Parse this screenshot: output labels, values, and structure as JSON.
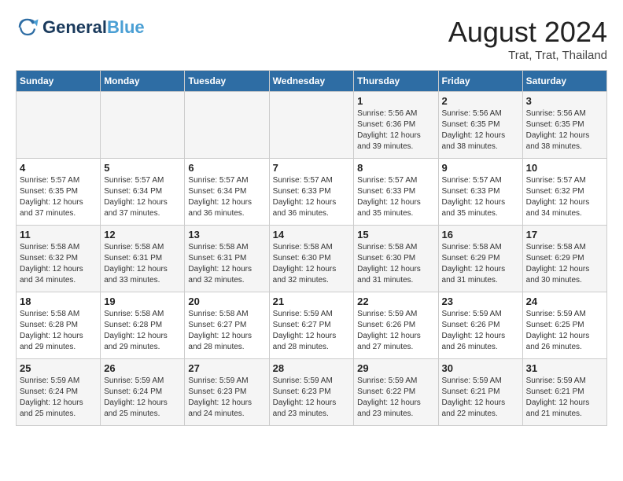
{
  "header": {
    "logo_line1": "General",
    "logo_line2": "Blue",
    "main_title": "August 2024",
    "subtitle": "Trat, Trat, Thailand"
  },
  "calendar": {
    "days_of_week": [
      "Sunday",
      "Monday",
      "Tuesday",
      "Wednesday",
      "Thursday",
      "Friday",
      "Saturday"
    ],
    "weeks": [
      [
        {
          "day": "",
          "info": ""
        },
        {
          "day": "",
          "info": ""
        },
        {
          "day": "",
          "info": ""
        },
        {
          "day": "",
          "info": ""
        },
        {
          "day": "1",
          "info": "Sunrise: 5:56 AM\nSunset: 6:36 PM\nDaylight: 12 hours\nand 39 minutes."
        },
        {
          "day": "2",
          "info": "Sunrise: 5:56 AM\nSunset: 6:35 PM\nDaylight: 12 hours\nand 38 minutes."
        },
        {
          "day": "3",
          "info": "Sunrise: 5:56 AM\nSunset: 6:35 PM\nDaylight: 12 hours\nand 38 minutes."
        }
      ],
      [
        {
          "day": "4",
          "info": "Sunrise: 5:57 AM\nSunset: 6:35 PM\nDaylight: 12 hours\nand 37 minutes."
        },
        {
          "day": "5",
          "info": "Sunrise: 5:57 AM\nSunset: 6:34 PM\nDaylight: 12 hours\nand 37 minutes."
        },
        {
          "day": "6",
          "info": "Sunrise: 5:57 AM\nSunset: 6:34 PM\nDaylight: 12 hours\nand 36 minutes."
        },
        {
          "day": "7",
          "info": "Sunrise: 5:57 AM\nSunset: 6:33 PM\nDaylight: 12 hours\nand 36 minutes."
        },
        {
          "day": "8",
          "info": "Sunrise: 5:57 AM\nSunset: 6:33 PM\nDaylight: 12 hours\nand 35 minutes."
        },
        {
          "day": "9",
          "info": "Sunrise: 5:57 AM\nSunset: 6:33 PM\nDaylight: 12 hours\nand 35 minutes."
        },
        {
          "day": "10",
          "info": "Sunrise: 5:57 AM\nSunset: 6:32 PM\nDaylight: 12 hours\nand 34 minutes."
        }
      ],
      [
        {
          "day": "11",
          "info": "Sunrise: 5:58 AM\nSunset: 6:32 PM\nDaylight: 12 hours\nand 34 minutes."
        },
        {
          "day": "12",
          "info": "Sunrise: 5:58 AM\nSunset: 6:31 PM\nDaylight: 12 hours\nand 33 minutes."
        },
        {
          "day": "13",
          "info": "Sunrise: 5:58 AM\nSunset: 6:31 PM\nDaylight: 12 hours\nand 32 minutes."
        },
        {
          "day": "14",
          "info": "Sunrise: 5:58 AM\nSunset: 6:30 PM\nDaylight: 12 hours\nand 32 minutes."
        },
        {
          "day": "15",
          "info": "Sunrise: 5:58 AM\nSunset: 6:30 PM\nDaylight: 12 hours\nand 31 minutes."
        },
        {
          "day": "16",
          "info": "Sunrise: 5:58 AM\nSunset: 6:29 PM\nDaylight: 12 hours\nand 31 minutes."
        },
        {
          "day": "17",
          "info": "Sunrise: 5:58 AM\nSunset: 6:29 PM\nDaylight: 12 hours\nand 30 minutes."
        }
      ],
      [
        {
          "day": "18",
          "info": "Sunrise: 5:58 AM\nSunset: 6:28 PM\nDaylight: 12 hours\nand 29 minutes."
        },
        {
          "day": "19",
          "info": "Sunrise: 5:58 AM\nSunset: 6:28 PM\nDaylight: 12 hours\nand 29 minutes."
        },
        {
          "day": "20",
          "info": "Sunrise: 5:58 AM\nSunset: 6:27 PM\nDaylight: 12 hours\nand 28 minutes."
        },
        {
          "day": "21",
          "info": "Sunrise: 5:59 AM\nSunset: 6:27 PM\nDaylight: 12 hours\nand 28 minutes."
        },
        {
          "day": "22",
          "info": "Sunrise: 5:59 AM\nSunset: 6:26 PM\nDaylight: 12 hours\nand 27 minutes."
        },
        {
          "day": "23",
          "info": "Sunrise: 5:59 AM\nSunset: 6:26 PM\nDaylight: 12 hours\nand 26 minutes."
        },
        {
          "day": "24",
          "info": "Sunrise: 5:59 AM\nSunset: 6:25 PM\nDaylight: 12 hours\nand 26 minutes."
        }
      ],
      [
        {
          "day": "25",
          "info": "Sunrise: 5:59 AM\nSunset: 6:24 PM\nDaylight: 12 hours\nand 25 minutes."
        },
        {
          "day": "26",
          "info": "Sunrise: 5:59 AM\nSunset: 6:24 PM\nDaylight: 12 hours\nand 25 minutes."
        },
        {
          "day": "27",
          "info": "Sunrise: 5:59 AM\nSunset: 6:23 PM\nDaylight: 12 hours\nand 24 minutes."
        },
        {
          "day": "28",
          "info": "Sunrise: 5:59 AM\nSunset: 6:23 PM\nDaylight: 12 hours\nand 23 minutes."
        },
        {
          "day": "29",
          "info": "Sunrise: 5:59 AM\nSunset: 6:22 PM\nDaylight: 12 hours\nand 23 minutes."
        },
        {
          "day": "30",
          "info": "Sunrise: 5:59 AM\nSunset: 6:21 PM\nDaylight: 12 hours\nand 22 minutes."
        },
        {
          "day": "31",
          "info": "Sunrise: 5:59 AM\nSunset: 6:21 PM\nDaylight: 12 hours\nand 21 minutes."
        }
      ]
    ]
  }
}
